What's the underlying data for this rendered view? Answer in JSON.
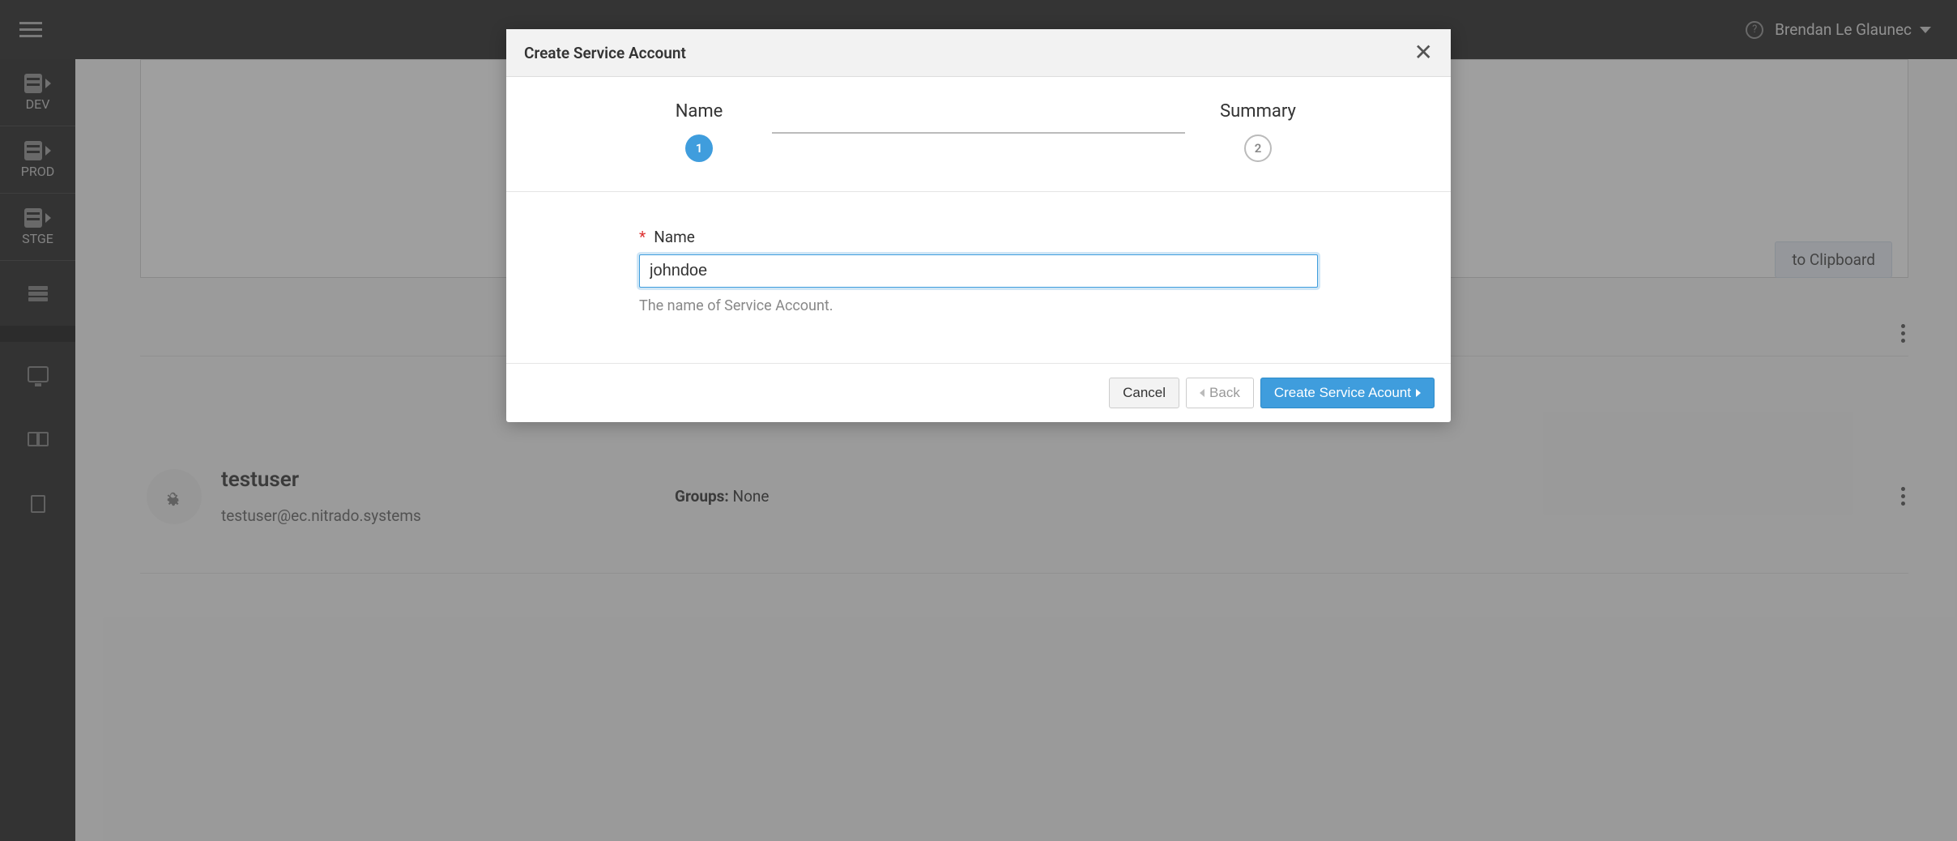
{
  "topbar": {
    "username": "Brendan Le Glaunec"
  },
  "sidebar": {
    "projects": [
      {
        "label": "DEV"
      },
      {
        "label": "PROD"
      },
      {
        "label": "STGE"
      }
    ]
  },
  "background": {
    "copy_button": "to Clipboard",
    "user": {
      "name": "testuser",
      "email": "testuser@ec.nitrado.systems",
      "groups_label": "Groups:",
      "groups_value": "None"
    }
  },
  "modal": {
    "title": "Create Service Account",
    "steps": {
      "name": "Name",
      "summary": "Summary",
      "num1": "1",
      "num2": "2"
    },
    "field": {
      "label": "Name",
      "value": "johndoe",
      "help": "The name of Service Account."
    },
    "buttons": {
      "cancel": "Cancel",
      "back": "Back",
      "submit": "Create Service Acount"
    }
  }
}
